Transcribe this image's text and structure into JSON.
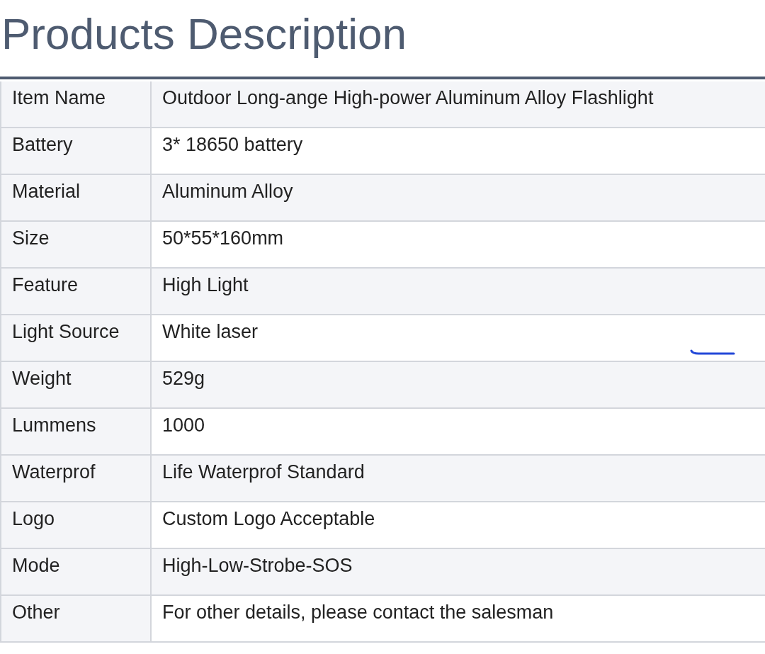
{
  "title": "Products Description",
  "rows": [
    {
      "label": "Item Name",
      "value": "Outdoor Long-ange High-power Aluminum Alloy Flashlight"
    },
    {
      "label": "Battery",
      "value": "3* 18650 battery"
    },
    {
      "label": "Material",
      "value": "Aluminum Alloy"
    },
    {
      "label": "Size",
      "value": "50*55*160mm"
    },
    {
      "label": "Feature",
      "value": "High Light"
    },
    {
      "label": "Light Source",
      "value": "White laser"
    },
    {
      "label": "Weight",
      "value": "529g"
    },
    {
      "label": "Lummens",
      "value": "1000"
    },
    {
      "label": "Waterprof",
      "value": "Life Waterprof Standard"
    },
    {
      "label": "Logo",
      "value": "Custom Logo Acceptable"
    },
    {
      "label": "Mode",
      "value": "High-Low-Strobe-SOS"
    },
    {
      "label": "Other",
      "value": "For other details, please contact the salesman"
    }
  ]
}
